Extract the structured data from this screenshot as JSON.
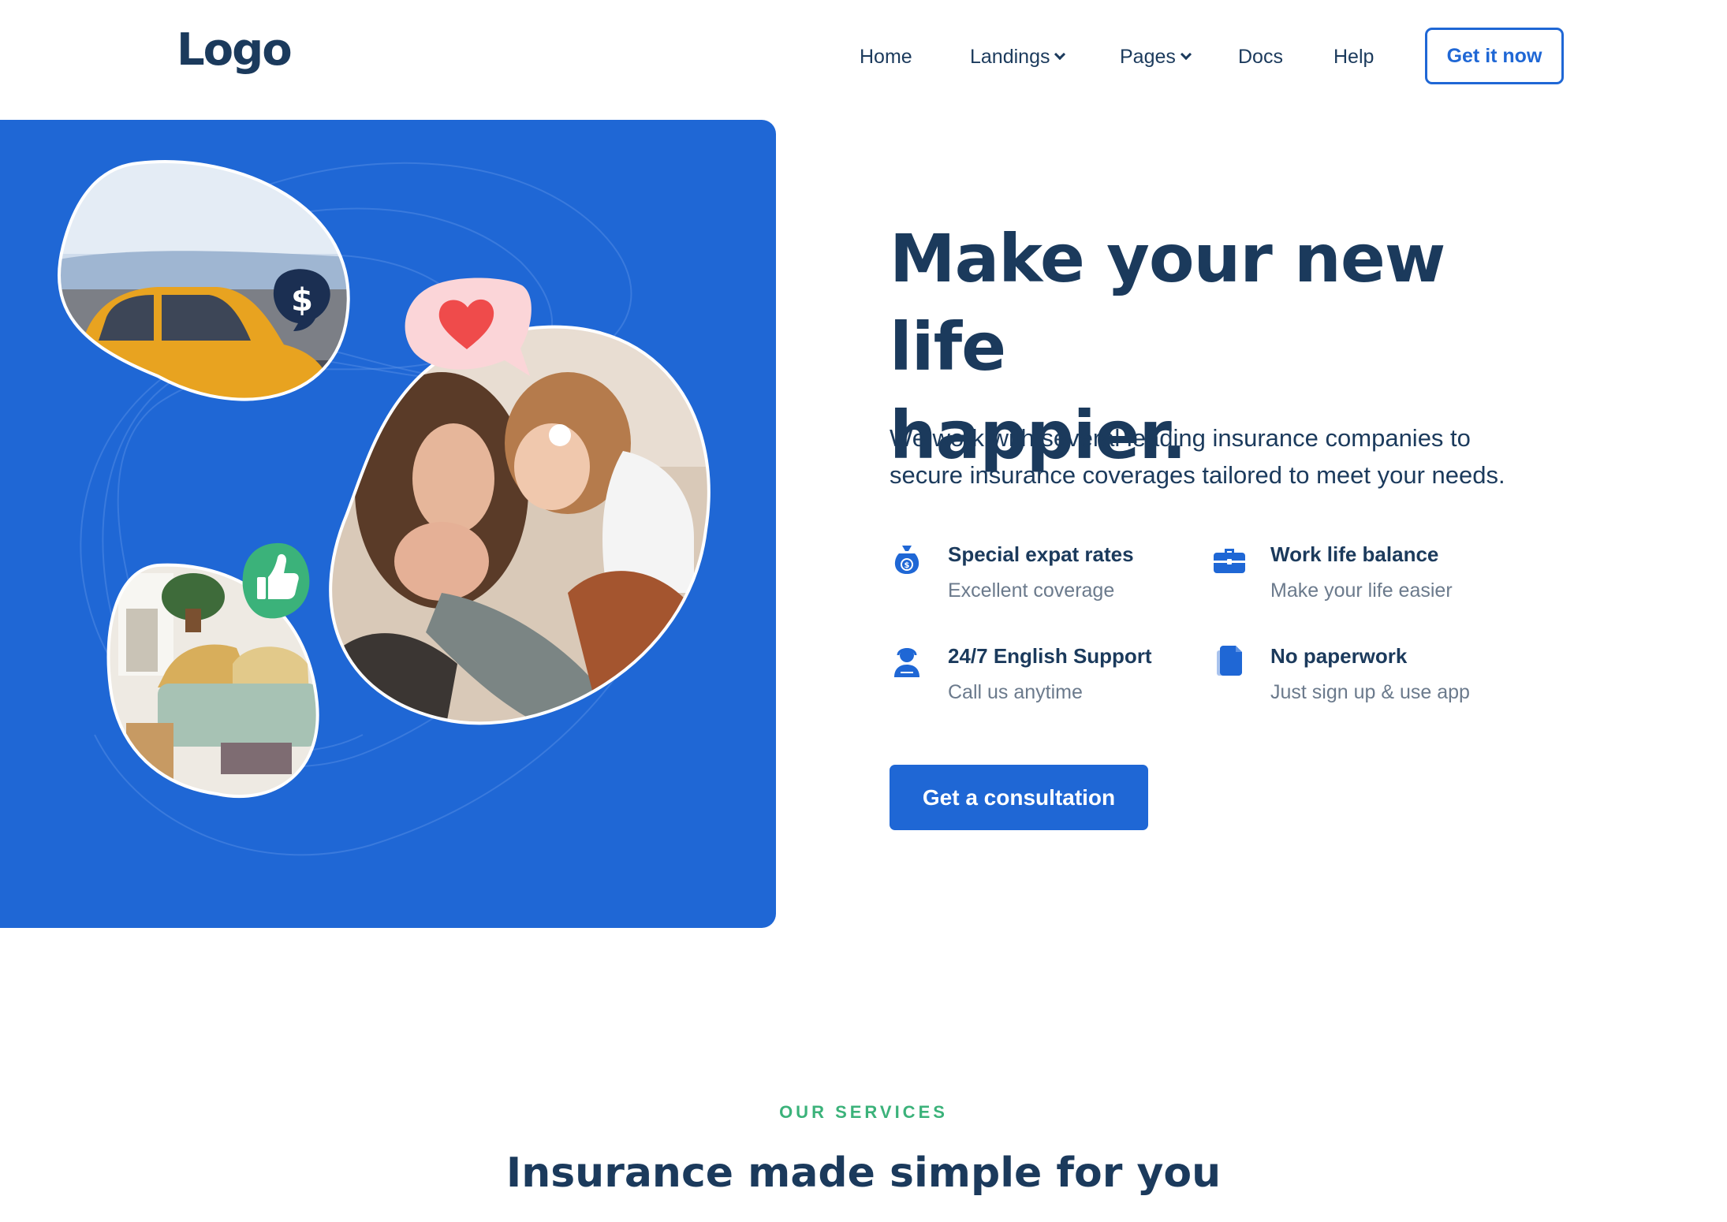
{
  "header": {
    "logo": "Logo",
    "nav": [
      {
        "label": "Home",
        "dropdown": false
      },
      {
        "label": "Landings",
        "dropdown": true
      },
      {
        "label": "Pages",
        "dropdown": true
      },
      {
        "label": "Docs",
        "dropdown": false
      },
      {
        "label": "Help",
        "dropdown": false
      }
    ],
    "cta": "Get it now"
  },
  "hero": {
    "title_line1": "Make your new life",
    "title_line2": "happier.",
    "subtitle_line1": "We work with several leading insurance companies to",
    "subtitle_line2": "secure insurance coverages tailored to meet your needs.",
    "features": [
      {
        "title": "Special expat rates",
        "subtitle": "Excellent coverage",
        "icon": "money-bag-icon"
      },
      {
        "title": "Work life balance",
        "subtitle": "Make your life easier",
        "icon": "briefcase-icon"
      },
      {
        "title": "24/7 English Support",
        "subtitle": "Call us anytime",
        "icon": "support-agent-icon"
      },
      {
        "title": "No paperwork",
        "subtitle": "Just sign up & use app",
        "icon": "document-icon"
      }
    ],
    "cta": "Get a consultation",
    "badges": {
      "dollar": "$"
    }
  },
  "services": {
    "eyebrow": "OUR SERVICES",
    "title": "Insurance made simple for you"
  },
  "colors": {
    "primary": "#1f67d5",
    "navy": "#1b3a5c",
    "muted": "#6b7a8c",
    "green": "#3bb27a",
    "pink": "#fbd5d8",
    "heart": "#ef4b4b"
  }
}
